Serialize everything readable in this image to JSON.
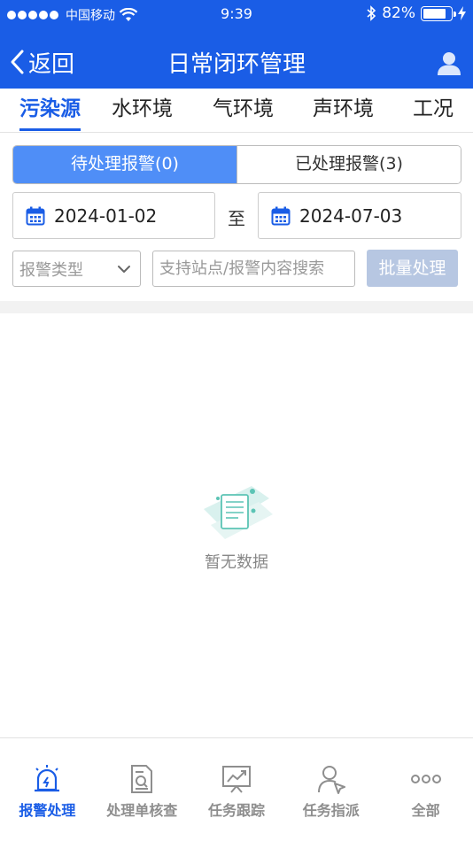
{
  "status_bar": {
    "carrier": "中国移动",
    "time": "9:39",
    "battery": "82%",
    "battery_level": 0.82
  },
  "nav": {
    "back_label": "返回",
    "title": "日常闭环管理"
  },
  "category_tabs": [
    {
      "label": "污染源",
      "active": true
    },
    {
      "label": "水环境",
      "active": false
    },
    {
      "label": "气环境",
      "active": false
    },
    {
      "label": "声环境",
      "active": false
    },
    {
      "label": "工况",
      "active": false
    }
  ],
  "segment": {
    "pending_label": "待处理报警(0)",
    "processed_label": "已处理报警(3)"
  },
  "date_range": {
    "start": "2024-01-02",
    "separator": "至",
    "end": "2024-07-03"
  },
  "filters": {
    "alarm_type_placeholder": "报警类型",
    "search_placeholder": "支持站点/报警内容搜索",
    "batch_label": "批量处理"
  },
  "empty_state": {
    "text": "暂无数据"
  },
  "tabbar": [
    {
      "label": "报警处理",
      "icon": "alarm-icon",
      "active": true
    },
    {
      "label": "处理单核查",
      "icon": "document-search-icon",
      "active": false
    },
    {
      "label": "任务跟踪",
      "icon": "trend-chart-icon",
      "active": false
    },
    {
      "label": "任务指派",
      "icon": "user-assign-icon",
      "active": false
    },
    {
      "label": "全部",
      "icon": "more-dots-icon",
      "active": false
    }
  ],
  "colors": {
    "primary": "#1a5de6",
    "segment_active": "#4f8ef7",
    "batch_disabled": "#b7c7e2",
    "tab_inactive": "#8e8e8e"
  }
}
